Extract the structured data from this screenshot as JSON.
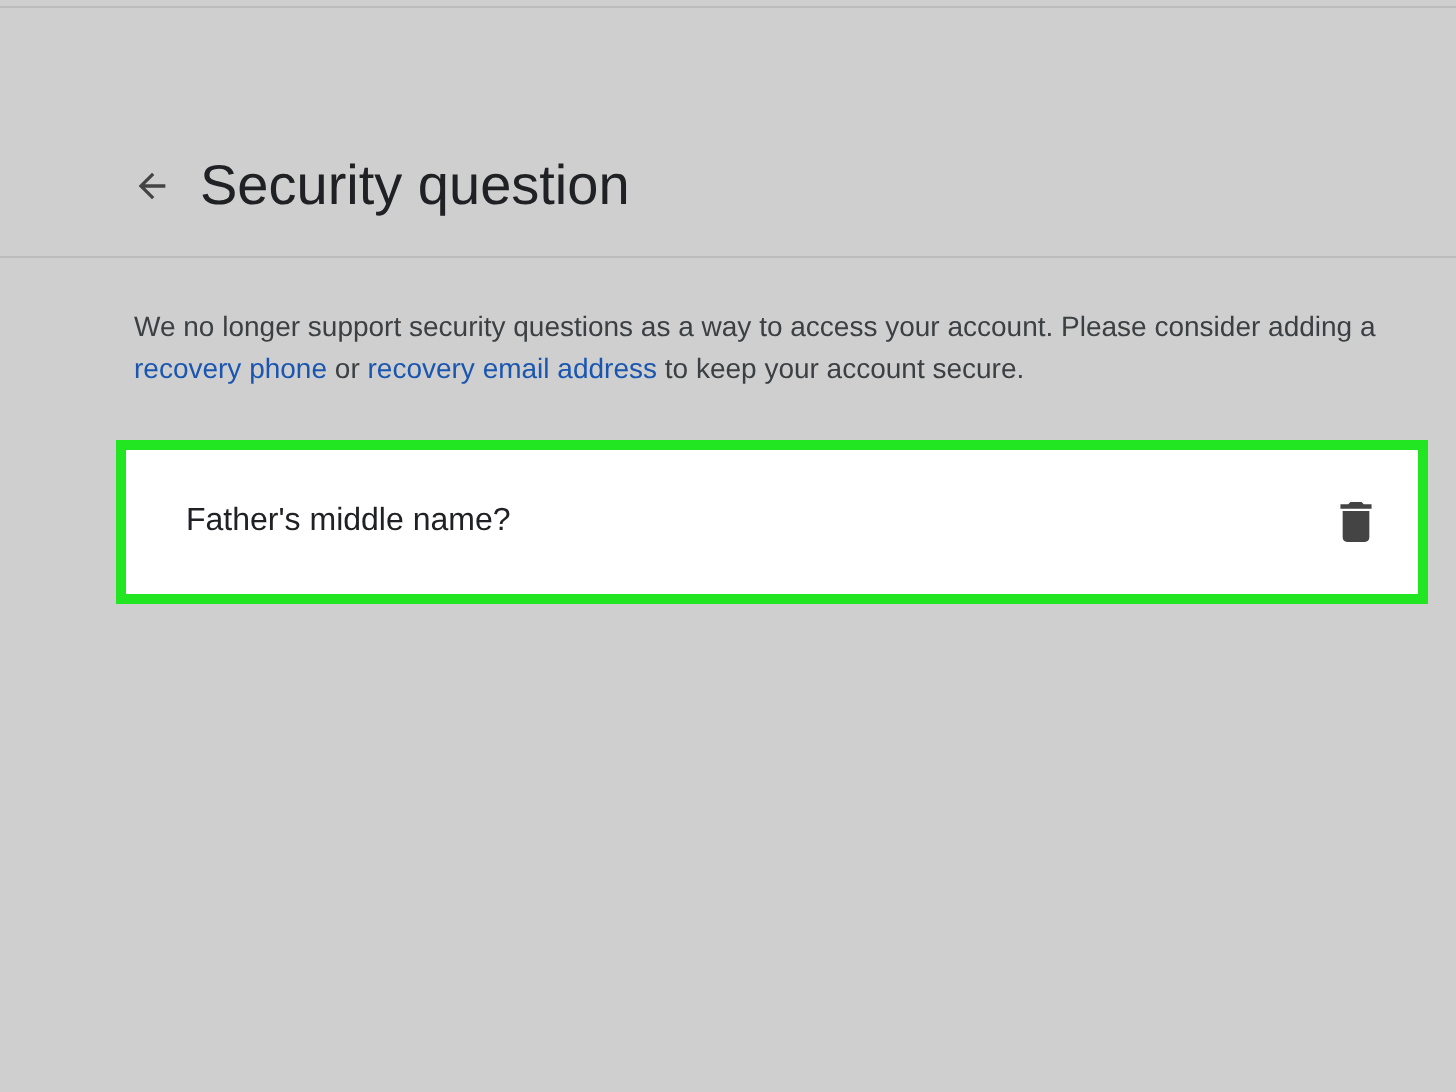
{
  "header": {
    "title": "Security question"
  },
  "notice": "We no longer support security questions as a way to access your account. Please consider adding a",
  "notice_links": [
    {
      "text": "recovery phone"
    },
    {
      "text": "recovery email address"
    }
  ],
  "notice_join": "or",
  "notice_end": "to keep your account secure.",
  "question": {
    "text": "Father's middle name?",
    "highlighted": true
  }
}
